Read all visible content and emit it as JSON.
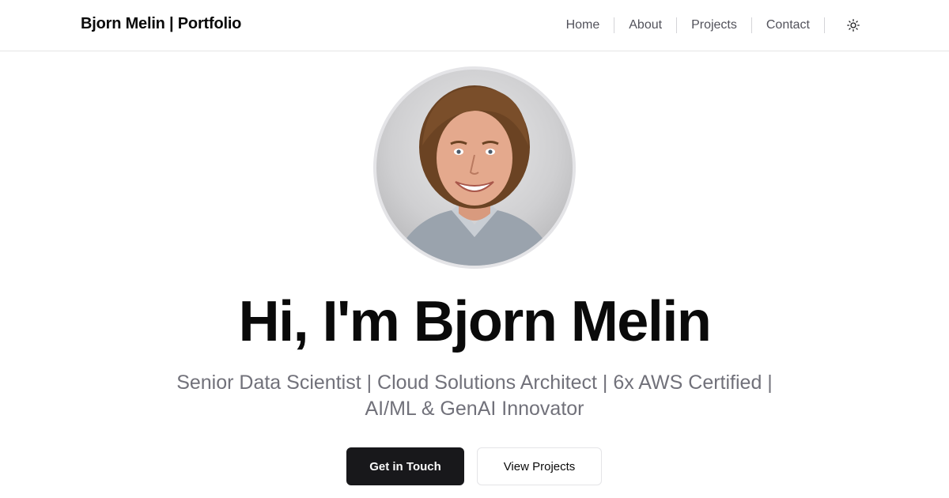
{
  "header": {
    "brand": "Bjorn Melin | Portfolio",
    "nav": [
      {
        "label": "Home"
      },
      {
        "label": "About"
      },
      {
        "label": "Projects"
      },
      {
        "label": "Contact"
      }
    ],
    "theme_toggle_icon": "sun-icon"
  },
  "hero": {
    "avatar_icon": "profile-photo",
    "title": "Hi, I'm Bjorn Melin",
    "subtitle": "Senior Data Scientist | Cloud Solutions Architect | 6x AWS Certified | AI/ML & GenAI Innovator",
    "primary_button": "Get in Touch",
    "secondary_button": "View Projects"
  },
  "colors": {
    "primary": "#18181b",
    "muted_text": "#71717a",
    "border": "#e4e4e7",
    "background": "#ffffff"
  }
}
